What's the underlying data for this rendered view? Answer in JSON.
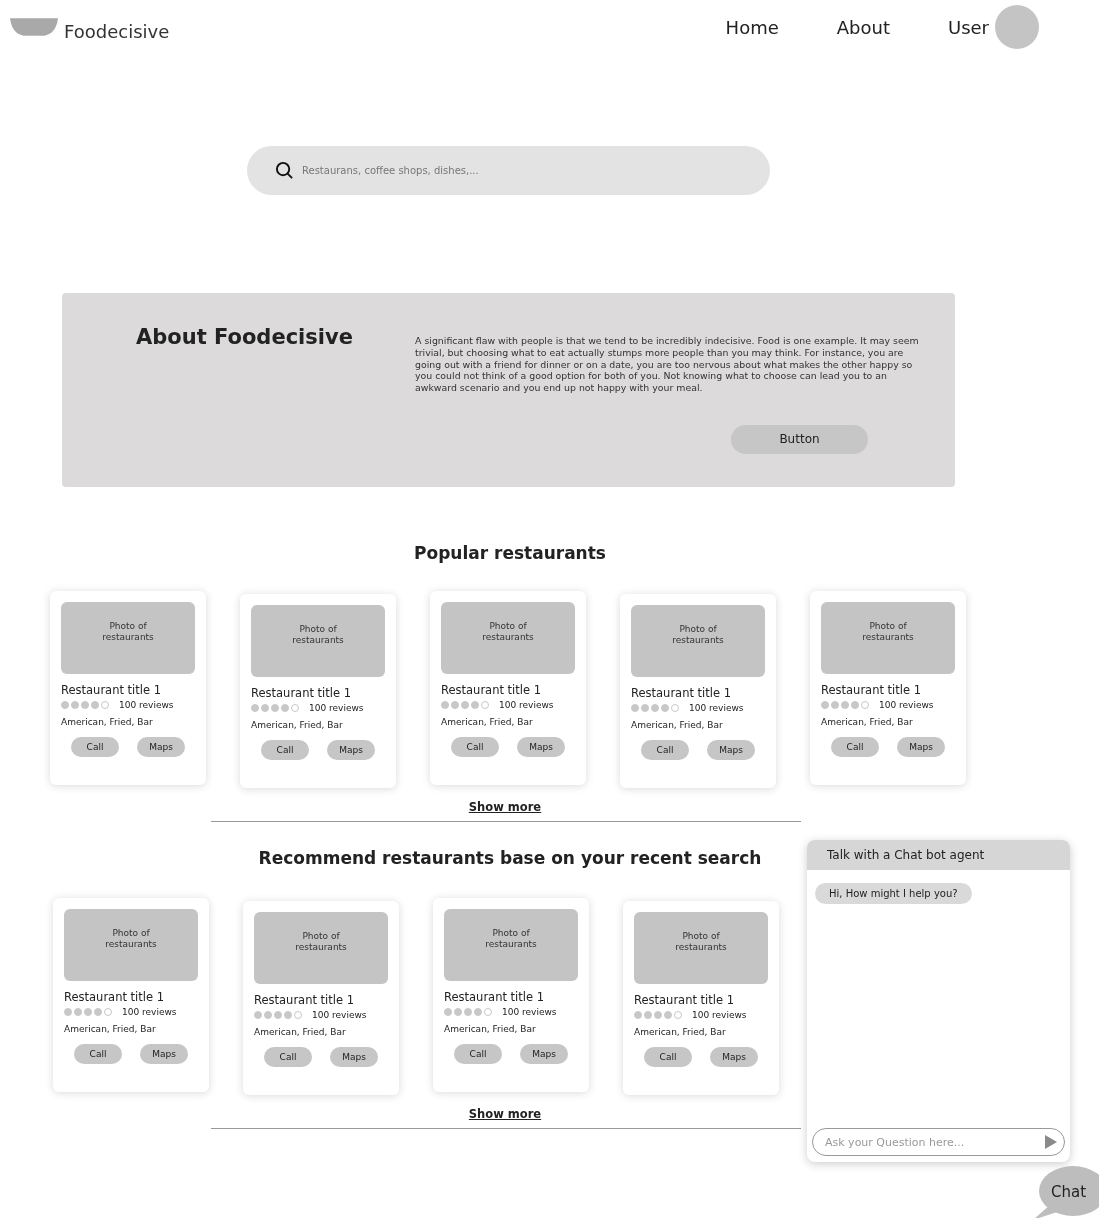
{
  "header": {
    "brand": "Foodecisive",
    "nav": [
      {
        "label": "Home"
      },
      {
        "label": "About"
      },
      {
        "label": "User"
      }
    ]
  },
  "search": {
    "placeholder": "Restaurans, coffee shops, dishes,..."
  },
  "about": {
    "title": "About Foodecisive",
    "text": "A significant flaw with people is that we tend to be incredibly indecisive. Food is one example. It may seem trivial, but choosing what to eat actually stumps more people than you may think. For instance, you are going out with a friend for dinner or on a date, you are too nervous about what makes the other happy so you could not think of a good option for both of you. Not knowing what to choose can lead you to an awkward scenario and you end up not happy with your meal.",
    "button": "Button"
  },
  "sections": [
    {
      "title": "Popular restaurants",
      "show_more": "Show more",
      "cards": [
        {
          "photo": "Photo of restaurants",
          "title": "Restaurant title 1",
          "stars": 4,
          "reviews": "100 reviews",
          "tags": "American, Fried, Bar",
          "buttons": [
            "Call",
            "Maps"
          ]
        },
        {
          "photo": "Photo of restaurants",
          "title": "Restaurant title 1",
          "stars": 4,
          "reviews": "100 reviews",
          "tags": "American, Fried, Bar",
          "buttons": [
            "Call",
            "Maps"
          ]
        },
        {
          "photo": "Photo of restaurants",
          "title": "Restaurant title 1",
          "stars": 4,
          "reviews": "100 reviews",
          "tags": "American, Fried, Bar",
          "buttons": [
            "Call",
            "Maps"
          ]
        },
        {
          "photo": "Photo of restaurants",
          "title": "Restaurant title 1",
          "stars": 4,
          "reviews": "100 reviews",
          "tags": "American, Fried, Bar",
          "buttons": [
            "Call",
            "Maps"
          ]
        },
        {
          "photo": "Photo of restaurants",
          "title": "Restaurant title 1",
          "stars": 4,
          "reviews": "100 reviews",
          "tags": "American, Fried, Bar",
          "buttons": [
            "Call",
            "Maps"
          ]
        }
      ]
    },
    {
      "title": "Recommend restaurants base on your recent search",
      "show_more": "Show more",
      "cards": [
        {
          "photo": "Photo of restaurants",
          "title": "Restaurant title 1",
          "stars": 4,
          "reviews": "100 reviews",
          "tags": "American, Fried, Bar",
          "buttons": [
            "Call",
            "Maps"
          ]
        },
        {
          "photo": "Photo of restaurants",
          "title": "Restaurant title 1",
          "stars": 4,
          "reviews": "100 reviews",
          "tags": "American, Fried, Bar",
          "buttons": [
            "Call",
            "Maps"
          ]
        },
        {
          "photo": "Photo of restaurants",
          "title": "Restaurant title 1",
          "stars": 4,
          "reviews": "100 reviews",
          "tags": "American, Fried, Bar",
          "buttons": [
            "Call",
            "Maps"
          ]
        },
        {
          "photo": "Photo of restaurants",
          "title": "Restaurant title 1",
          "stars": 4,
          "reviews": "100 reviews",
          "tags": "American, Fried, Bar",
          "buttons": [
            "Call",
            "Maps"
          ]
        }
      ]
    }
  ],
  "chat": {
    "title": "Talk with a Chat bot agent",
    "messages": [
      "Hi, How might I help you?"
    ],
    "placeholder": "Ask your Question here...",
    "bubble": "Chat"
  }
}
